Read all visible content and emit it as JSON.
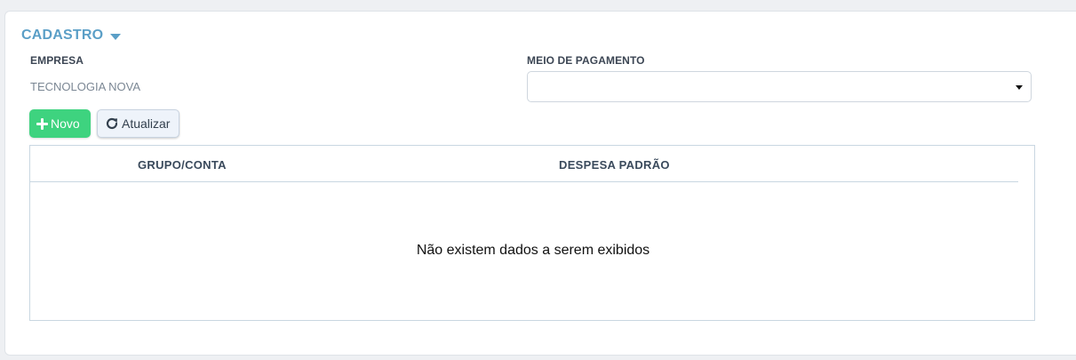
{
  "section": {
    "title": "CADASTRO"
  },
  "fields": {
    "empresa_label": "EMPRESA",
    "empresa_value": "TECNOLOGIA NOVA",
    "meio_pagamento_label": "MEIO DE PAGAMENTO",
    "meio_pagamento_value": ""
  },
  "toolbar": {
    "new_label": "Novo",
    "refresh_label": "Atualizar"
  },
  "table": {
    "columns": [
      "GRUPO/CONTA",
      "DESPESA PADRÃO"
    ],
    "rows": [],
    "empty_message": "Não existem dados a serem exibidos"
  },
  "icons": {
    "section_toggle": "caret-down-icon",
    "select_arrow": "caret-down-icon",
    "new": "plus-icon",
    "refresh": "refresh-icon"
  },
  "colors": {
    "section_title": "#5b9fc7",
    "new_button": "#3ed37f",
    "refresh_button_bg": "#eef3fa",
    "table_border": "#c9d7e1"
  }
}
